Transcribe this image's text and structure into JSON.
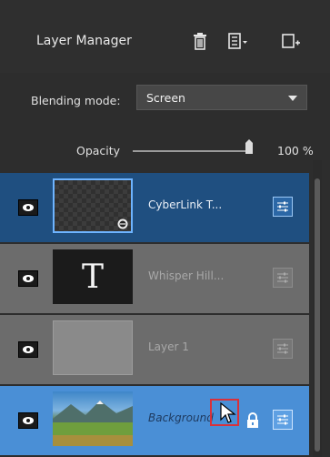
{
  "header": {
    "title": "Layer Manager",
    "icons": [
      "trash-icon",
      "list-menu-icon",
      "add-layer-icon"
    ]
  },
  "blending": {
    "label": "Blending mode:",
    "value": "Screen"
  },
  "opacity": {
    "label": "Opacity",
    "value_text": "100 %",
    "value": 100
  },
  "layers": [
    {
      "name": "CyberLink T...",
      "type": "transparent",
      "selected": true
    },
    {
      "name": "Whisper Hill...",
      "type": "text",
      "thumb_text": "T"
    },
    {
      "name": "Layer 1",
      "type": "gray"
    },
    {
      "name": "Background",
      "type": "photo",
      "locked": true,
      "selected": true
    }
  ],
  "colors": {
    "panel": "#2d2d2d",
    "selected_dark": "#1f4f80",
    "selected_light": "#4a8fd6",
    "layer_normal": "#6c6c6c",
    "highlight": "#d9313a"
  }
}
